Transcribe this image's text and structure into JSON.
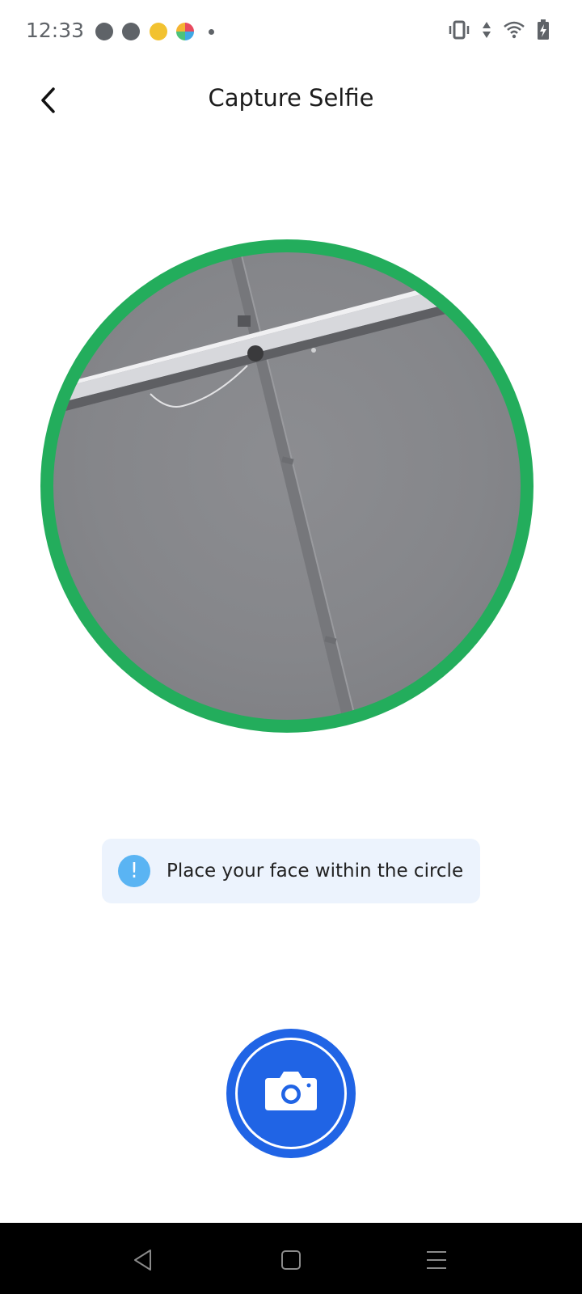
{
  "status_bar": {
    "time": "12:33",
    "icons": [
      "notification-p-icon",
      "phone-icon",
      "emoji-icon",
      "app-color-icon",
      "more-dot-icon",
      "vibrate-icon",
      "data-arrows-icon",
      "wifi-icon",
      "battery-charging-icon"
    ]
  },
  "header": {
    "title": "Capture Selfie",
    "back_icon": "chevron-left-icon"
  },
  "camera_preview": {
    "ring_color": "#23ad5c"
  },
  "hint": {
    "icon": "!",
    "text": "Place your face within the circle",
    "background": "#ecf3fd",
    "icon_color": "#5ab4f3"
  },
  "capture": {
    "icon": "camera-icon",
    "color": "#2064e5"
  },
  "nav_bar": {
    "buttons": [
      "back-triangle-icon",
      "home-square-icon",
      "menu-lines-icon"
    ]
  }
}
